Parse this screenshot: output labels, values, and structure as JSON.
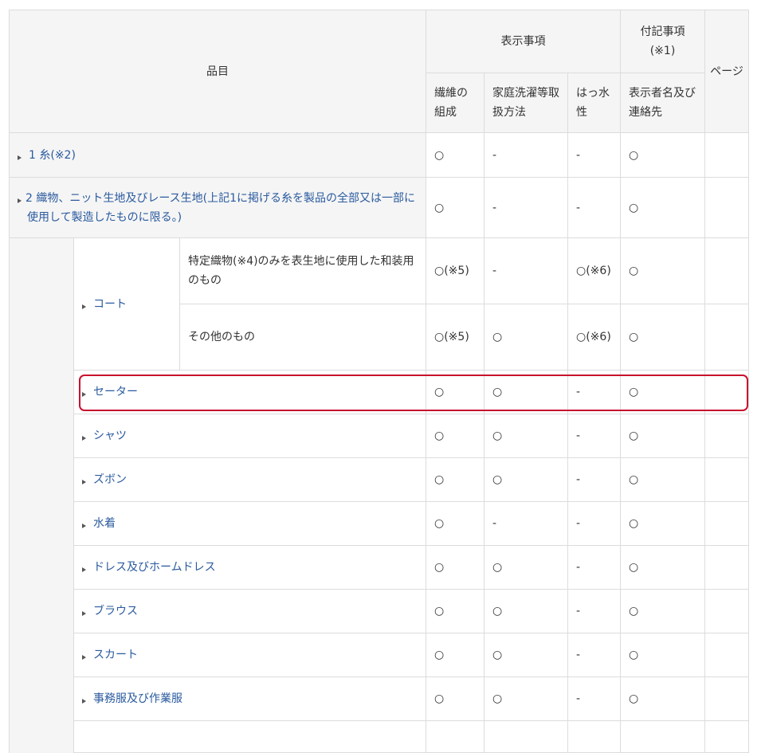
{
  "header": {
    "item": "品目",
    "display_group": "表示事項",
    "supplementary_group": "付記事項(※1)",
    "page": "ページ",
    "col_fiber": "繊維の組成",
    "col_washing": "家庭洗濯等取扱方法",
    "col_water": "はっ水性",
    "col_labeler": "表示者名及び連絡先"
  },
  "rows": {
    "r1": {
      "label": "1 糸(※2)",
      "fiber": "○",
      "washing": "-",
      "water": "-",
      "labeler": "○"
    },
    "r2": {
      "label": "2 織物、ニット生地及びレース生地(上記1に掲げる糸を製品の全部又は一部に使用して製造したものに限る。)",
      "fiber": "○",
      "washing": "-",
      "water": "-",
      "labeler": "○"
    },
    "coat": {
      "label": "コート",
      "sub1": {
        "label": "特定織物(※4)のみを表生地に使用した和装用のもの",
        "fiber": "○(※5)",
        "washing": "-",
        "water": "○(※6)",
        "labeler": "○"
      },
      "sub2": {
        "label": "その他のもの",
        "fiber": "○(※5)",
        "washing": "○",
        "water": "○(※6)",
        "labeler": "○"
      }
    },
    "sweater": {
      "label": "セーター",
      "fiber": "○",
      "washing": "○",
      "water": "-",
      "labeler": "○"
    },
    "shirt": {
      "label": "シャツ",
      "fiber": "○",
      "washing": "○",
      "water": "-",
      "labeler": "○"
    },
    "pants": {
      "label": "ズボン",
      "fiber": "○",
      "washing": "○",
      "water": "-",
      "labeler": "○"
    },
    "swimwear": {
      "label": "水着",
      "fiber": "○",
      "washing": "-",
      "water": "-",
      "labeler": "○"
    },
    "dress": {
      "label": "ドレス及びホームドレス",
      "fiber": "○",
      "washing": "○",
      "water": "-",
      "labeler": "○"
    },
    "blouse": {
      "label": "ブラウス",
      "fiber": "○",
      "washing": "○",
      "water": "-",
      "labeler": "○"
    },
    "skirt": {
      "label": "スカート",
      "fiber": "○",
      "washing": "○",
      "water": "-",
      "labeler": "○"
    },
    "office": {
      "label": "事務服及び作業服",
      "fiber": "○",
      "washing": "○",
      "water": "-",
      "labeler": "○"
    }
  },
  "colors": {
    "link": "#2a5a9e",
    "highlight": "#c8102e",
    "header_bg": "#f5f5f5",
    "border": "#dcdcdc"
  }
}
